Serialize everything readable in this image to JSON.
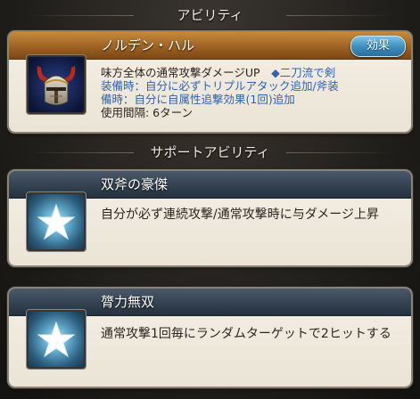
{
  "ability_section": {
    "header": "アビリティ",
    "ability": {
      "name": "ノルデン・ハル",
      "effect_button": "効果",
      "desc_line1": "味方全体の通常攻撃ダメージUP",
      "desc_line1_hl": "◆二刀流で剣",
      "desc_line2": "装備時：自分に必ずトリプルアタック追加/斧装",
      "desc_line3": "備時：自分に自属性追撃効果(1回)追加",
      "cooldown": "使用間隔: 6ターン",
      "icon": "horned-helmet-icon"
    }
  },
  "support_section": {
    "header": "サポートアビリティ",
    "abilities": [
      {
        "name": "双斧の豪傑",
        "desc": "自分が必ず連続攻撃/通常攻撃時に与ダメージ上昇",
        "icon": "star-icon"
      },
      {
        "name": "膂力無双",
        "desc": "通常攻撃1回毎にランダムターゲットで2ヒットする",
        "icon": "star-icon"
      }
    ]
  },
  "colors": {
    "ability_title": "#9a5f22",
    "support_title": "#32404f",
    "effect_button": "#3c8cbc",
    "highlight_text": "#2f63b0"
  }
}
